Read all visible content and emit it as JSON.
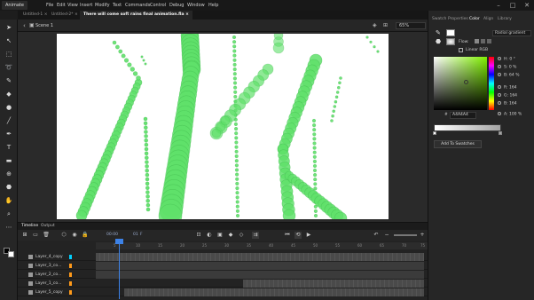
{
  "menubar": {
    "app": "Animate",
    "items": [
      "File",
      "Edit",
      "View",
      "Insert",
      "Modify",
      "Text",
      "Commands",
      "Control",
      "Debug",
      "Window",
      "Help"
    ],
    "title": "There will come soft rains final animation.fla",
    "window_controls": [
      "–",
      "□",
      "✕"
    ]
  },
  "doc_tabs": [
    "Untitled-1 ×",
    "Untitled-2* ×",
    "There will come soft rains final animation.fla ×"
  ],
  "stage": {
    "scene": "Scene 1",
    "zoom": "65%"
  },
  "tools": [
    {
      "icon": "selection-arrow-icon",
      "glyph": "➤"
    },
    {
      "icon": "subselection-icon",
      "glyph": "↖"
    },
    {
      "icon": "free-transform-icon",
      "glyph": "⬚"
    },
    {
      "icon": "lasso-icon",
      "glyph": "➰"
    },
    {
      "icon": "pencil-icon",
      "glyph": "✎"
    },
    {
      "icon": "eraser-icon",
      "glyph": "◆"
    },
    {
      "icon": "oval-icon",
      "glyph": "●"
    },
    {
      "icon": "line-icon",
      "glyph": "╱"
    },
    {
      "icon": "pen-icon",
      "glyph": "✒"
    },
    {
      "icon": "text-icon",
      "glyph": "T"
    },
    {
      "icon": "rectangle-icon",
      "glyph": "▬"
    },
    {
      "icon": "eyedropper-icon",
      "glyph": "⊕"
    },
    {
      "icon": "bucket-icon",
      "glyph": "⬣"
    },
    {
      "icon": "hand-icon",
      "glyph": "✋"
    },
    {
      "icon": "zoom-icon",
      "glyph": "⌕"
    },
    {
      "icon": "more-tools-icon",
      "glyph": "⋯"
    }
  ],
  "right_panel": {
    "tabs": [
      "Swatch",
      "Properties",
      "Color",
      "Align",
      "Library"
    ],
    "active_tab": "Color",
    "gradient_type": "Radial gradient",
    "flow_label": "Flow:",
    "linear_rgb_label": "Linear RGB",
    "hsb": [
      {
        "label": "H:",
        "value": "0 °"
      },
      {
        "label": "S:",
        "value": "0 %"
      },
      {
        "label": "B:",
        "value": "64 %"
      },
      {
        "label": "R:",
        "value": "164"
      },
      {
        "label": "G:",
        "value": "164"
      },
      {
        "label": "B:",
        "value": "164"
      },
      {
        "label": "A:",
        "value": "100 %"
      }
    ],
    "hex_prefix": "#",
    "hex": "A4A4A4",
    "add_swatch": "Add To Swatches"
  },
  "timeline": {
    "tabs": [
      "Timeline",
      "Output"
    ],
    "time": "00:00",
    "frame": "01",
    "frame_unit": "F",
    "layers": [
      {
        "name": "Layer_4_copy",
        "color": "#00d0ff"
      },
      {
        "name": "Layer_3_co...",
        "color": "#ff9a1a"
      },
      {
        "name": "Layer_2_co...",
        "color": "#ff9a1a"
      },
      {
        "name": "Layer_1_co...",
        "color": "#ff9a1a"
      },
      {
        "name": "Layer_5_copy",
        "color": "#ff9a1a"
      }
    ],
    "ruler_labels": [
      "5",
      "10",
      "15",
      "20",
      "25",
      "30",
      "35",
      "40",
      "45",
      "50",
      "55",
      "60",
      "65",
      "70",
      "75"
    ],
    "play_icon": "play-icon",
    "loop_icon": "loop-icon"
  },
  "colors": {
    "accent": "#3d82e6",
    "drop_green": "#5fe06a",
    "canvas": "#ffffff"
  }
}
